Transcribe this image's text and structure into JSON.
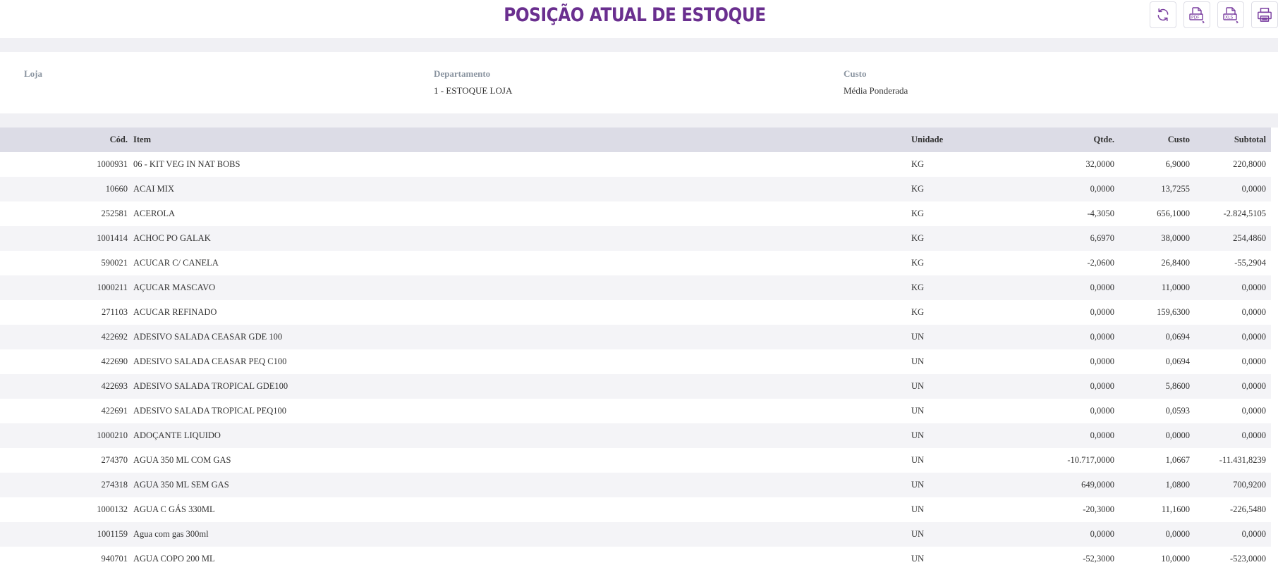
{
  "header": {
    "title": "POSIÇÃO ATUAL DE ESTOQUE",
    "toolbar": [
      {
        "name": "refresh-button",
        "icon": "refresh-icon",
        "label": ""
      },
      {
        "name": "export-pdf-button",
        "icon": "pdf-icon",
        "label": "PDF"
      },
      {
        "name": "export-xls-button",
        "icon": "xls-icon",
        "label": "XLS"
      },
      {
        "name": "print-button",
        "icon": "printer-icon",
        "label": ""
      }
    ]
  },
  "filters": {
    "loja": {
      "label": "Loja",
      "value": ""
    },
    "departamento": {
      "label": "Departamento",
      "value": "1 - ESTOQUE LOJA"
    },
    "custo": {
      "label": "Custo",
      "value": "Média Ponderada"
    }
  },
  "table": {
    "columns": {
      "cod": "Cód.",
      "item": "Item",
      "unidade": "Unidade",
      "qtde": "Qtde.",
      "custo": "Custo",
      "subtotal": "Subtotal"
    },
    "rows": [
      {
        "cod": "1000931",
        "item": "06 - KIT VEG IN NAT BOBS",
        "unidade": "KG",
        "qtde": "32,0000",
        "custo": "6,9000",
        "subtotal": "220,8000"
      },
      {
        "cod": "10660",
        "item": "ACAI MIX",
        "unidade": "KG",
        "qtde": "0,0000",
        "custo": "13,7255",
        "subtotal": "0,0000"
      },
      {
        "cod": "252581",
        "item": "ACEROLA",
        "unidade": "KG",
        "qtde": "-4,3050",
        "custo": "656,1000",
        "subtotal": "-2.824,5105"
      },
      {
        "cod": "1001414",
        "item": "ACHOC PO GALAK",
        "unidade": "KG",
        "qtde": "6,6970",
        "custo": "38,0000",
        "subtotal": "254,4860"
      },
      {
        "cod": "590021",
        "item": "ACUCAR C/ CANELA",
        "unidade": "KG",
        "qtde": "-2,0600",
        "custo": "26,8400",
        "subtotal": "-55,2904"
      },
      {
        "cod": "1000211",
        "item": "AÇUCAR MASCAVO",
        "unidade": "KG",
        "qtde": "0,0000",
        "custo": "11,0000",
        "subtotal": "0,0000"
      },
      {
        "cod": "271103",
        "item": "ACUCAR REFINADO",
        "unidade": "KG",
        "qtde": "0,0000",
        "custo": "159,6300",
        "subtotal": "0,0000"
      },
      {
        "cod": "422692",
        "item": "ADESIVO SALADA CEASAR GDE 100",
        "unidade": "UN",
        "qtde": "0,0000",
        "custo": "0,0694",
        "subtotal": "0,0000"
      },
      {
        "cod": "422690",
        "item": "ADESIVO SALADA CEASAR PEQ C100",
        "unidade": "UN",
        "qtde": "0,0000",
        "custo": "0,0694",
        "subtotal": "0,0000"
      },
      {
        "cod": "422693",
        "item": "ADESIVO SALADA TROPICAL GDE100",
        "unidade": "UN",
        "qtde": "0,0000",
        "custo": "5,8600",
        "subtotal": "0,0000"
      },
      {
        "cod": "422691",
        "item": "ADESIVO SALADA TROPICAL PEQ100",
        "unidade": "UN",
        "qtde": "0,0000",
        "custo": "0,0593",
        "subtotal": "0,0000"
      },
      {
        "cod": "1000210",
        "item": "ADOÇANTE LIQUIDO",
        "unidade": "UN",
        "qtde": "0,0000",
        "custo": "0,0000",
        "subtotal": "0,0000"
      },
      {
        "cod": "274370",
        "item": "AGUA 350 ML COM GAS",
        "unidade": "UN",
        "qtde": "-10.717,0000",
        "custo": "1,0667",
        "subtotal": "-11.431,8239"
      },
      {
        "cod": "274318",
        "item": "AGUA 350 ML SEM GAS",
        "unidade": "UN",
        "qtde": "649,0000",
        "custo": "1,0800",
        "subtotal": "700,9200"
      },
      {
        "cod": "1000132",
        "item": "AGUA C GÁS 330ML",
        "unidade": "UN",
        "qtde": "-20,3000",
        "custo": "11,1600",
        "subtotal": "-226,5480"
      },
      {
        "cod": "1001159",
        "item": "Agua com gas 300ml",
        "unidade": "UN",
        "qtde": "0,0000",
        "custo": "0,0000",
        "subtotal": "0,0000"
      },
      {
        "cod": "940701",
        "item": "AGUA COPO 200 ML",
        "unidade": "UN",
        "qtde": "-52,3000",
        "custo": "10,0000",
        "subtotal": "-523,0000"
      }
    ]
  },
  "colors": {
    "title": "#6a2f8f",
    "icon": "#7a3fa0",
    "header_row": "#dcdce6",
    "stripe": "#f4f4f7",
    "band": "#f0f0f4",
    "filter_label": "#8a94a0"
  }
}
